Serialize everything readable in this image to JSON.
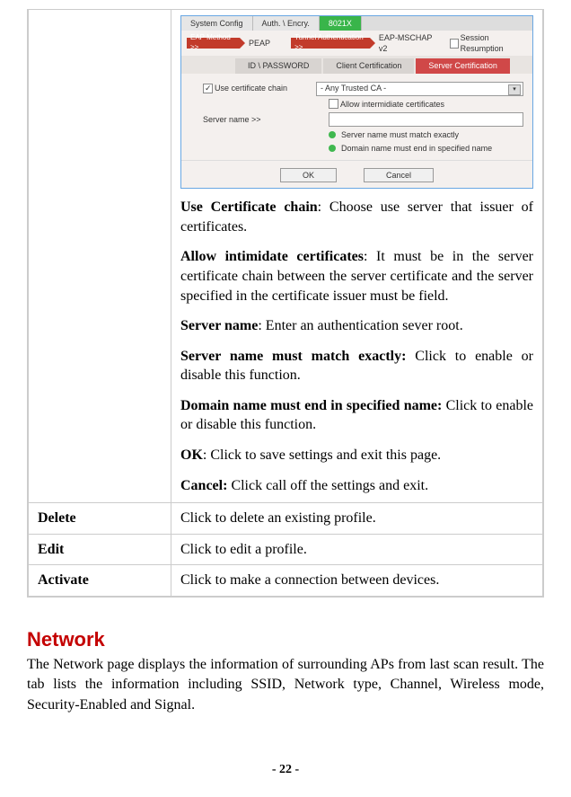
{
  "shot": {
    "tabs1": [
      "System Config",
      "Auth. \\ Encry.",
      "8021X"
    ],
    "tabs1_active": 2,
    "row1": {
      "arrow1": "EAP Method >>",
      "val1": "PEAP",
      "arrow2": "Tunnel Authentication >>",
      "val2": "EAP-MSCHAP v2",
      "chk1": "Session Resumption"
    },
    "tabs2": [
      "ID \\ PASSWORD",
      "Client Certification",
      "Server Certification"
    ],
    "tabs2_active": 2,
    "use_cert_chain": "Use certificate chain",
    "any_trusted": "- Any Trusted CA -",
    "allow_inter": "Allow intermidiate certificates",
    "server_name_lbl": "Server name >>",
    "radio1": "Server name must match exactly",
    "radio2": "Domain name must end in specified name",
    "ok": "OK",
    "cancel": "Cancel"
  },
  "defs": [
    {
      "b": "Use Certificate chain",
      "t": ": Choose use server that issuer of certificates."
    },
    {
      "b": "Allow intimidate certificates",
      "t": ": It must be in the server certificate chain between the server certificate and the server specified in the certificate issuer must be field."
    },
    {
      "b": "Server name",
      "t": ": Enter an authentication sever root."
    },
    {
      "b": "Server name must match exactly:",
      "t": " Click to enable or disable this function."
    },
    {
      "b": "Domain name must end in specified name:",
      "t": " Click to enable or disable this function."
    },
    {
      "b": "OK",
      "t": ": Click to save settings and exit this page."
    },
    {
      "b": "Cancel:",
      "t": " Click call off the settings and exit."
    }
  ],
  "rows": [
    {
      "label": "Delete",
      "desc": "Click to delete an existing profile."
    },
    {
      "label": "Edit",
      "desc": "Click to edit a profile."
    },
    {
      "label": "Activate",
      "desc": "Click to make a connection between devices."
    }
  ],
  "heading": "Network",
  "network_body": "The Network page displays the information of surrounding APs from last scan result. The tab lists the information including SSID, Network type, Channel, Wireless mode, Security-Enabled and Signal.",
  "page_number": "- 22 -"
}
